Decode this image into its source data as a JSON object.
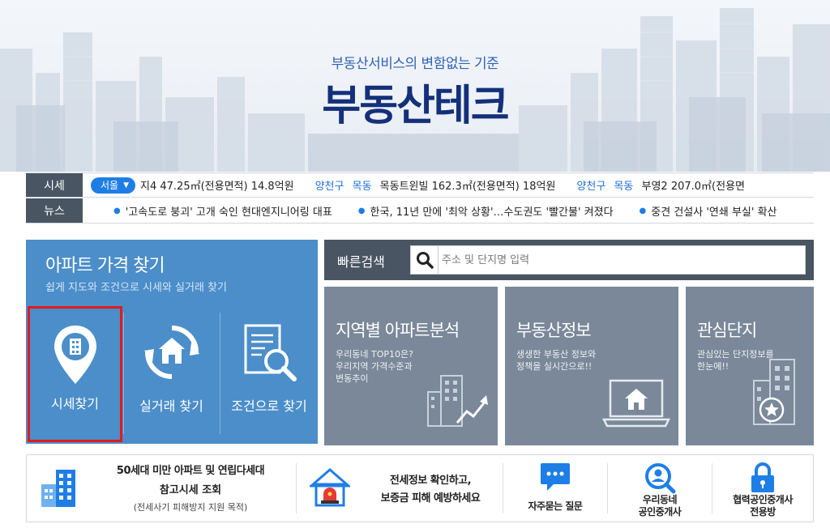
{
  "hero": {
    "subtitle": "부동산서비스의 변함없는 기준",
    "title": "부동산테크"
  },
  "ticker": {
    "price_label": "시세",
    "region": "서울",
    "price_items": [
      {
        "gu": "",
        "dong": "",
        "text": "지4  47.25㎡(전용면적)  14.8억원"
      },
      {
        "gu": "양천구",
        "dong": "목동",
        "text": "목동트윈빌  162.3㎡(전용면적)  18억원"
      },
      {
        "gu": "양천구",
        "dong": "목동",
        "text": "부영2  207.0㎡(전용면"
      }
    ],
    "news_label": "뉴스",
    "news_items": [
      "'고속도로 붕괴' 고개 숙인 현대엔지니어링 대표",
      "한국, 11년 만에 '최악 상황'…수도권도 '빨간불' 켜졌다",
      "중견 건설사 '연쇄 부실' 확산"
    ]
  },
  "apt_search": {
    "title": "아파트 가격 찾기",
    "desc": "쉽게 지도와 조건으로 시세와 실거래 찾기",
    "buttons": [
      "시세찾기",
      "실거래 찾기",
      "조건으로 찾기"
    ]
  },
  "quick_search": {
    "label": "빠른검색",
    "placeholder": "주소 및 단지명 입력"
  },
  "tiles": [
    {
      "title": "지역별 아파트분석",
      "desc": [
        "우리동네 TOP10은?",
        "우리지역 가격수준과",
        "변동추이"
      ]
    },
    {
      "title": "부동산정보",
      "desc": [
        "생생한 부동산 정보와",
        "정책을 실시간으로!!"
      ]
    },
    {
      "title": "관심단지",
      "desc": [
        "관심있는 단지정보를",
        "한눈에!!"
      ]
    }
  ],
  "services": {
    "s1": [
      "50세대 미만 아파트 및 연립다세대",
      "참고시세 조회",
      "(전세사기 피해방지 지원 목적)"
    ],
    "s2": [
      "전세정보 확인하고,",
      "보증금 피해 예방하세요"
    ],
    "s3": "자주묻는 질문",
    "s4": [
      "우리동네",
      "공인중개사"
    ],
    "s5": [
      "협력공인중개사",
      "전용방"
    ]
  },
  "colors": {
    "accent_blue": "#1f7ee6",
    "title_navy": "#14307a",
    "panel_blue": "#4b8ec9",
    "tile_grey": "#7a8899",
    "dark_bar": "#4a5563",
    "highlight_red": "#e11b1b"
  }
}
